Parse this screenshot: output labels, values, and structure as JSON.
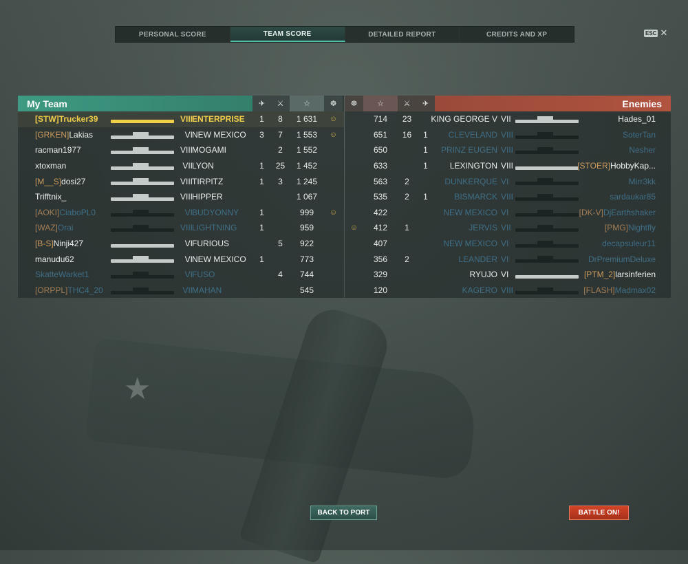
{
  "tabs": [
    {
      "label": "PERSONAL SCORE",
      "active": false
    },
    {
      "label": "TEAM SCORE",
      "active": true
    },
    {
      "label": "DETAILED REPORT",
      "active": false
    },
    {
      "label": "CREDITS AND XP",
      "active": false
    }
  ],
  "esc": {
    "key": "ESC",
    "close": "✕"
  },
  "my_team": {
    "title": "My Team",
    "col_icons": [
      "plane-icon",
      "torpedo-icon",
      "star-icon",
      "medal-icon"
    ],
    "rows": [
      {
        "clan": "[STW]",
        "name": "Trucker39",
        "tier": "VIII",
        "ship": "ENTERPRISE",
        "c1": "1",
        "c2": "8",
        "score": "1 631",
        "badge": "☺",
        "style": "gold",
        "cv": true
      },
      {
        "clan": "[GRKEN]",
        "name": "Lakias",
        "tier": "VI",
        "ship": "NEW MEXICO",
        "c1": "3",
        "c2": "7",
        "score": "1 553",
        "badge": "☺",
        "style": "",
        "cv": false
      },
      {
        "clan": "",
        "name": "racman1977",
        "tier": "VIII",
        "ship": "MOGAMI",
        "c1": "",
        "c2": "2",
        "score": "1 552",
        "badge": "",
        "style": "",
        "cv": false
      },
      {
        "clan": "",
        "name": "xtoxman",
        "tier": "VII",
        "ship": "LYON",
        "c1": "1",
        "c2": "25",
        "score": "1 452",
        "badge": "",
        "style": "",
        "cv": false
      },
      {
        "clan": "[M__S]",
        "name": "dosi27",
        "tier": "VIII",
        "ship": "TIRPITZ",
        "c1": "1",
        "c2": "3",
        "score": "1 245",
        "badge": "",
        "style": "",
        "cv": false
      },
      {
        "clan": "",
        "name": "Trifftnix_",
        "tier": "VIII",
        "ship": "HIPPER",
        "c1": "",
        "c2": "",
        "score": "1 067",
        "badge": "",
        "style": "",
        "cv": false
      },
      {
        "clan": "[AOKI]",
        "name": "CiaboPL0",
        "tier": "VI",
        "ship": "BUDYONNY",
        "c1": "1",
        "c2": "",
        "score": "999",
        "badge": "☺",
        "style": "dim",
        "cv": false
      },
      {
        "clan": "[WAZ]",
        "name": "Orai",
        "tier": "VIII",
        "ship": "LIGHTNING",
        "c1": "1",
        "c2": "",
        "score": "959",
        "badge": "",
        "style": "dim",
        "cv": false
      },
      {
        "clan": "[B-S]",
        "name": "Ninji427",
        "tier": "VI",
        "ship": "FURIOUS",
        "c1": "",
        "c2": "5",
        "score": "922",
        "badge": "",
        "style": "",
        "cv": true
      },
      {
        "clan": "",
        "name": "manudu62",
        "tier": "VI",
        "ship": "NEW MEXICO",
        "c1": "1",
        "c2": "",
        "score": "773",
        "badge": "",
        "style": "",
        "cv": false
      },
      {
        "clan": "",
        "name": "SkatteWarket1",
        "tier": "VI",
        "ship": "FUSO",
        "c1": "",
        "c2": "4",
        "score": "744",
        "badge": "",
        "style": "dim",
        "cv": false
      },
      {
        "clan": "[ORPPL]",
        "name": "THC4_20",
        "tier": "VII",
        "ship": "MAHAN",
        "c1": "",
        "c2": "",
        "score": "545",
        "badge": "",
        "style": "dim",
        "cv": false
      }
    ]
  },
  "enemies": {
    "title": "Enemies",
    "rows": [
      {
        "badge": "",
        "score": "714",
        "c2": "23",
        "c1": "",
        "ship": "KING GEORGE V",
        "tier": "VII",
        "clan": "",
        "name": "Hades_01",
        "style": "",
        "cv": false
      },
      {
        "badge": "",
        "score": "651",
        "c2": "16",
        "c1": "1",
        "ship": "CLEVELAND",
        "tier": "VIII",
        "clan": "",
        "name": "SoterTan",
        "style": "dim",
        "cv": false
      },
      {
        "badge": "",
        "score": "650",
        "c2": "",
        "c1": "1",
        "ship": "PRINZ EUGEN",
        "tier": "VIII",
        "clan": "",
        "name": "Nesher",
        "style": "dim",
        "cv": false
      },
      {
        "badge": "",
        "score": "633",
        "c2": "",
        "c1": "1",
        "ship": "LEXINGTON",
        "tier": "VIII",
        "clan": "[STOER]",
        "name": "HobbyKap...",
        "style": "",
        "cv": true
      },
      {
        "badge": "",
        "score": "563",
        "c2": "2",
        "c1": "",
        "ship": "DUNKERQUE",
        "tier": "VI",
        "clan": "",
        "name": "Mirr3kk",
        "style": "dim",
        "cv": false
      },
      {
        "badge": "",
        "score": "535",
        "c2": "2",
        "c1": "1",
        "ship": "BISMARCK",
        "tier": "VIII",
        "clan": "",
        "name": "sardaukar85",
        "style": "dim",
        "cv": false
      },
      {
        "badge": "",
        "score": "422",
        "c2": "",
        "c1": "",
        "ship": "NEW MEXICO",
        "tier": "VI",
        "clan": "[DK-V]",
        "name": "DjEarthshaker",
        "style": "dim",
        "cv": false
      },
      {
        "badge": "☺",
        "score": "412",
        "c2": "1",
        "c1": "",
        "ship": "JERVIS",
        "tier": "VII",
        "clan": "[PMG]",
        "name": "Nightfly",
        "style": "dim",
        "cv": false
      },
      {
        "badge": "",
        "score": "407",
        "c2": "",
        "c1": "",
        "ship": "NEW MEXICO",
        "tier": "VI",
        "clan": "",
        "name": "decapsuleur11",
        "style": "dim",
        "cv": false
      },
      {
        "badge": "",
        "score": "356",
        "c2": "2",
        "c1": "",
        "ship": "LEANDER",
        "tier": "VI",
        "clan": "",
        "name": "DrPremiumDeluxe",
        "style": "dim",
        "cv": false
      },
      {
        "badge": "",
        "score": "329",
        "c2": "",
        "c1": "",
        "ship": "RYUJO",
        "tier": "VI",
        "clan": "[PTM_2]",
        "name": "larsinferien",
        "style": "",
        "cv": true
      },
      {
        "badge": "",
        "score": "120",
        "c2": "",
        "c1": "",
        "ship": "KAGERO",
        "tier": "VIII",
        "clan": "[FLASH]",
        "name": "Madmax02",
        "style": "dim",
        "cv": false
      }
    ]
  },
  "buttons": {
    "back": "BACK TO PORT",
    "battle": "BATTLE ON!"
  }
}
